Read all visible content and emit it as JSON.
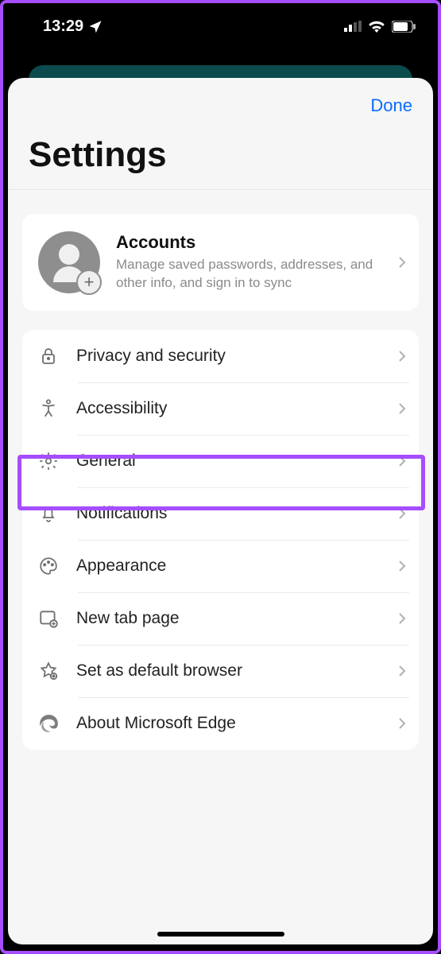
{
  "status": {
    "time": "13:29"
  },
  "nav": {
    "done": "Done"
  },
  "page": {
    "title": "Settings"
  },
  "account": {
    "title": "Accounts",
    "subtitle": "Manage saved passwords, addresses, and other info, and sign in to sync"
  },
  "rows": [
    {
      "icon": "lock-icon",
      "label": "Privacy and security"
    },
    {
      "icon": "accessibility-icon",
      "label": "Accessibility"
    },
    {
      "icon": "gear-icon",
      "label": "General"
    },
    {
      "icon": "bell-icon",
      "label": "Notifications"
    },
    {
      "icon": "palette-icon",
      "label": "Appearance"
    },
    {
      "icon": "newtab-icon",
      "label": "New tab page"
    },
    {
      "icon": "star-gear-icon",
      "label": "Set as default browser"
    },
    {
      "icon": "edge-icon",
      "label": "About Microsoft Edge"
    }
  ]
}
